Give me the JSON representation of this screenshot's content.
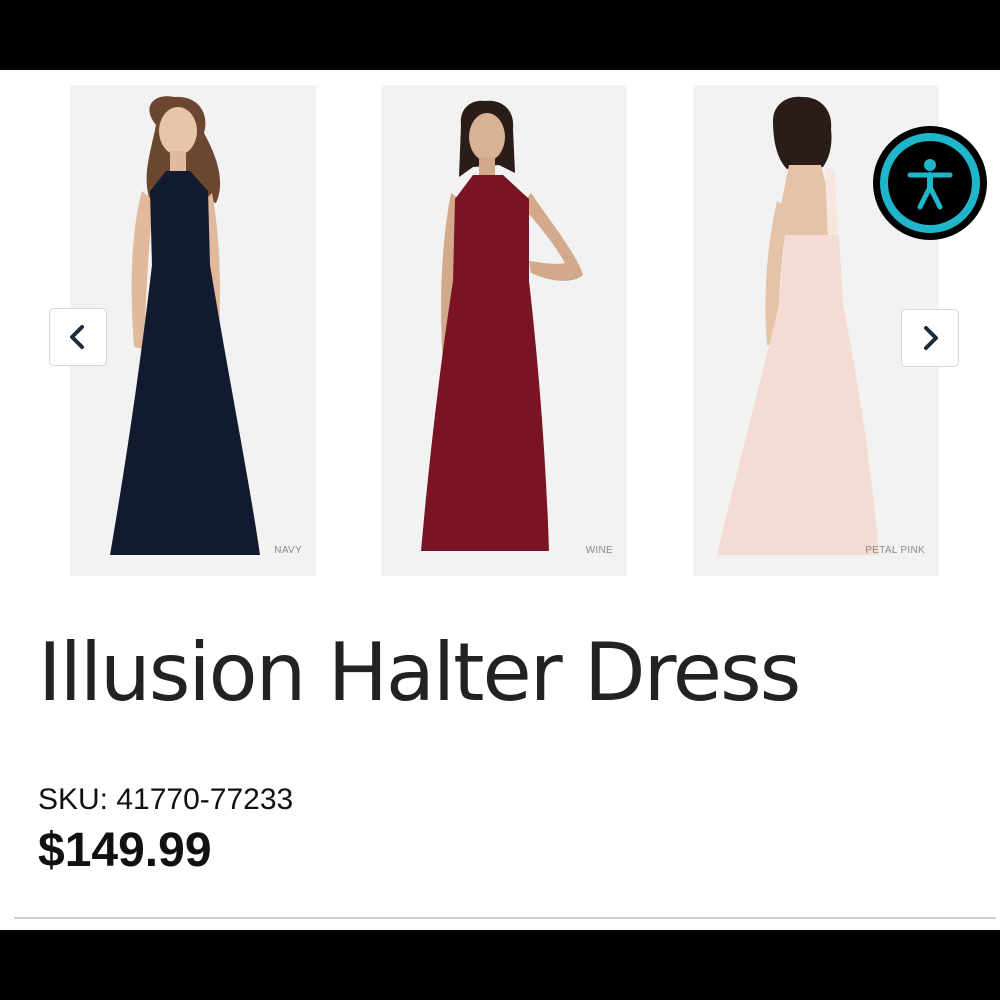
{
  "carousel": {
    "items": [
      {
        "label": "NAVY",
        "color": "#111a2e"
      },
      {
        "label": "WINE",
        "color": "#7a1424"
      },
      {
        "label": "PETAL PINK",
        "color": "#f4dcd4"
      }
    ],
    "prev_icon": "chevron-left-icon",
    "next_icon": "chevron-right-icon"
  },
  "accessibility": {
    "icon": "accessibility-icon",
    "accent_color": "#1fb6c9"
  },
  "product": {
    "title": "Illusion Halter Dress",
    "sku_label": "SKU:",
    "sku_value": "41770-77233",
    "price": "$149.99"
  }
}
